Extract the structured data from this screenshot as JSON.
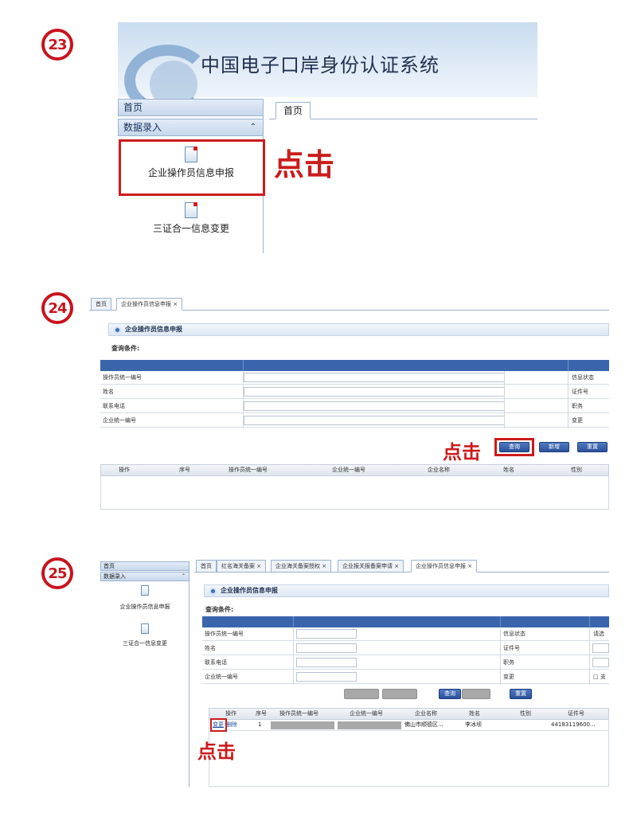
{
  "steps": {
    "s23": "23",
    "s24": "24",
    "s25": "25"
  },
  "click_text": "点击",
  "panel23": {
    "system_title": "中国电子口岸身份认证系统",
    "accordion_home": "首页",
    "accordion_data_entry": "数据录入",
    "nav_items": [
      "企业操作员信息申报",
      "三证合一信息变更"
    ],
    "tab_home": "首页"
  },
  "panel24": {
    "tabs": [
      "首页",
      "企业操作员信息申报 ×"
    ],
    "section_title": "企业操作员信息申报",
    "query_conditions": "查询条件:",
    "form_rows": [
      {
        "label": "操作员统一编号",
        "right_label": "信息状态"
      },
      {
        "label": "姓名",
        "right_label": "证件号"
      },
      {
        "label": "联系电话",
        "right_label": "职务"
      },
      {
        "label": "企业统一编号",
        "right_label": "变更"
      }
    ],
    "buttons": [
      "查询",
      "新增",
      "重置"
    ],
    "result_columns": [
      "操作",
      "序号",
      "操作员统一编号",
      "企业统一编号",
      "企业名称",
      "姓名",
      "性别"
    ]
  },
  "panel25": {
    "accordion_home": "首页",
    "accordion_data_entry": "数据录入",
    "nav_items": [
      "企业操作员信息申报",
      "三证合一信息变更"
    ],
    "tabs": [
      "首页",
      "红名海关备案 ×",
      "企业海关备案授权 ×",
      "企业报关报备案申请 ×",
      "企业操作员信息申报 ×"
    ],
    "section_title": "企业操作员信息申报",
    "query_conditions": "查询条件:",
    "form_rows": [
      {
        "label": "操作员统一编号",
        "right_label": "信息状态",
        "right_value": "请选"
      },
      {
        "label": "姓名",
        "right_label": "证件号",
        "right_value": ""
      },
      {
        "label": "联系电话",
        "right_label": "职务",
        "right_value": ""
      },
      {
        "label": "企业统一编号",
        "right_label": "变更",
        "right_value": "□ 支"
      }
    ],
    "buttons": [
      "查询",
      "重置"
    ],
    "result_columns": [
      "操作",
      "序号",
      "操作员统一编号",
      "企业统一编号",
      "企业名称",
      "姓名",
      "性别",
      "证件号"
    ],
    "result_rows": [
      {
        "action_change": "变更",
        "action_delete": "删除",
        "index": "1",
        "company_name": "佛山市顺德区...",
        "name": "李冰坝",
        "id_number": "44183119600..."
      }
    ]
  }
}
